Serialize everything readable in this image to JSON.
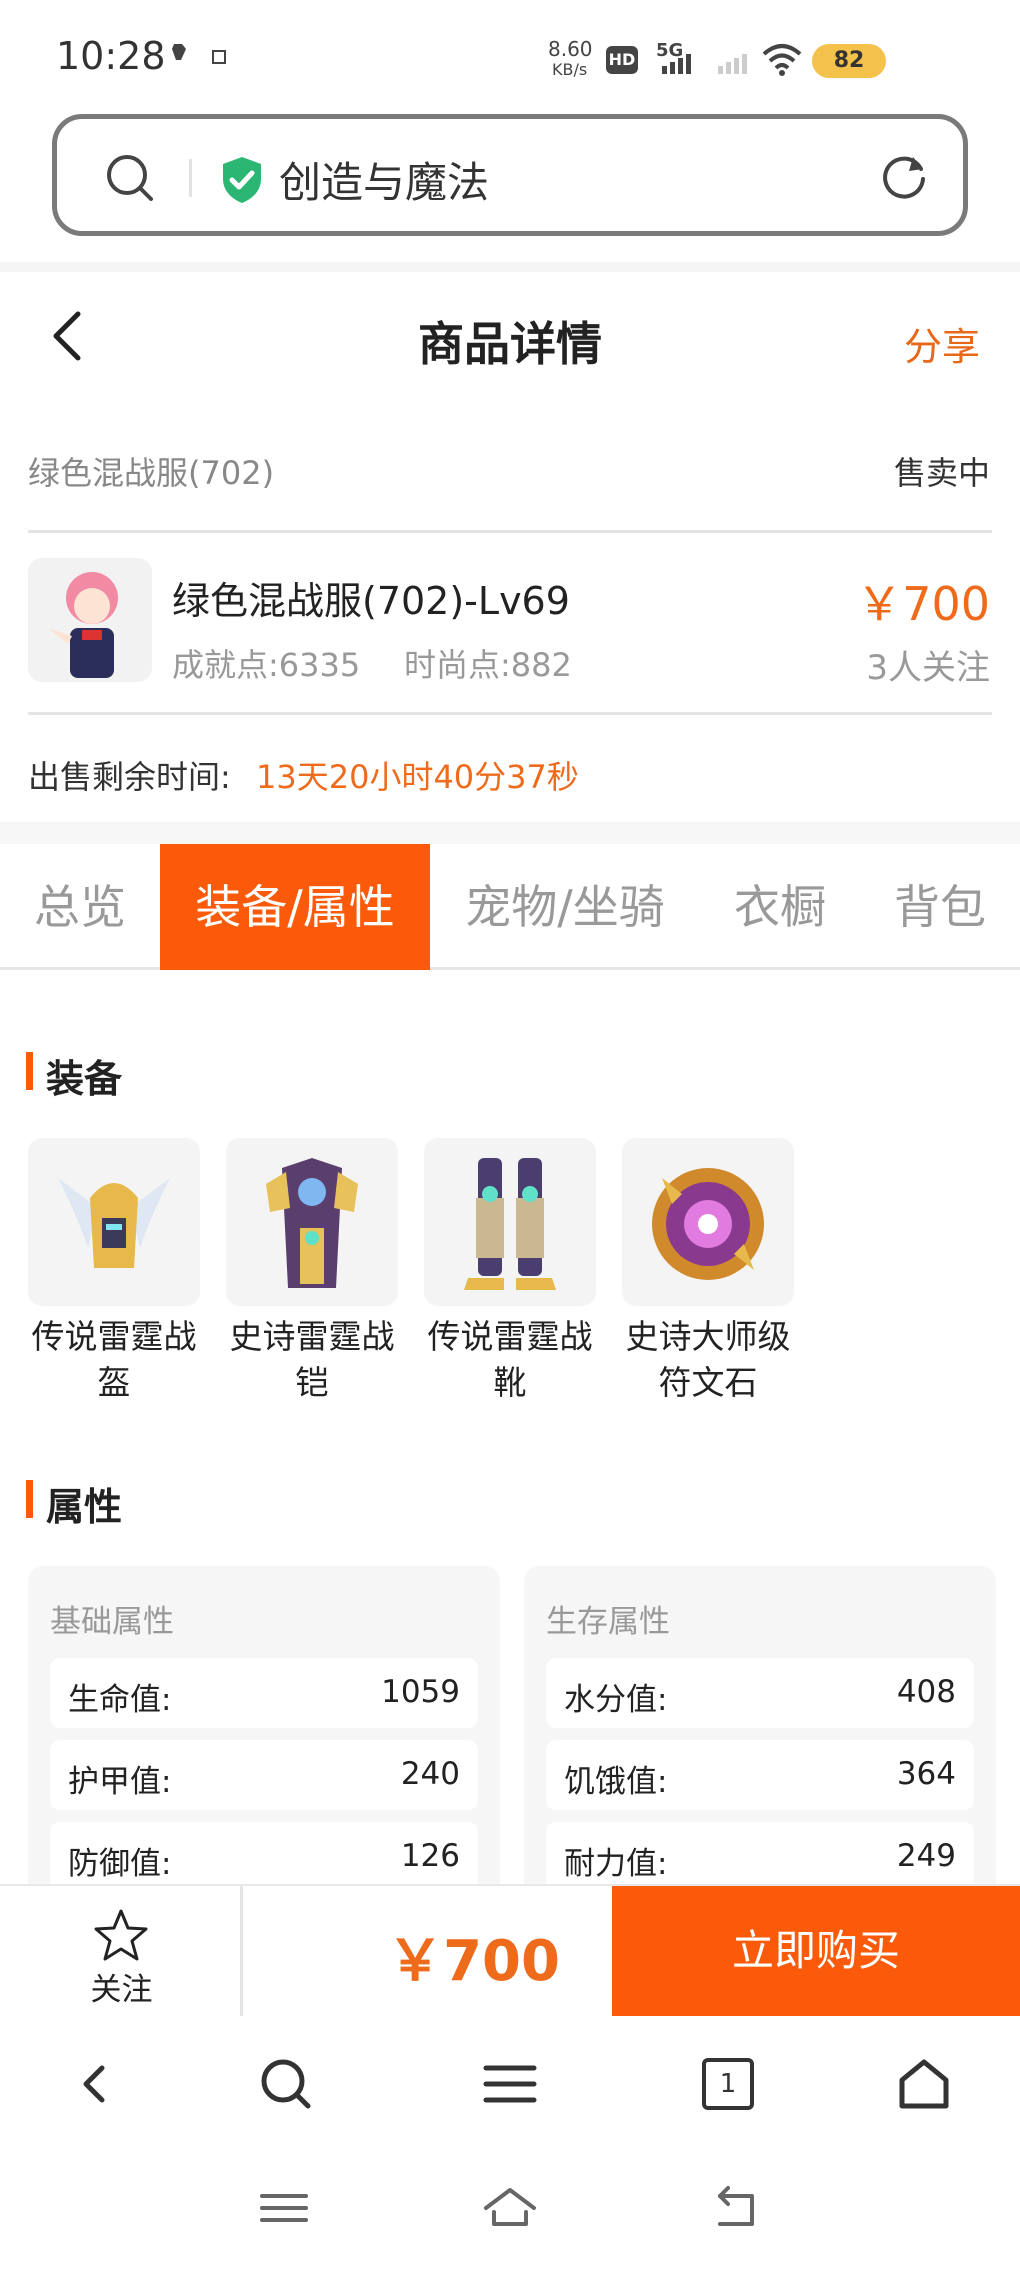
{
  "status_bar": {
    "time": "10:28",
    "net_speed_value": "8.60",
    "net_speed_unit": "KB/s",
    "hd_label": "HD",
    "network_label": "5G",
    "battery": "82"
  },
  "address_bar": {
    "text": "创造与魔法"
  },
  "header": {
    "title": "商品详情",
    "share": "分享"
  },
  "item": {
    "name_small": "绿色混战服(702)",
    "status": "售卖中",
    "title": "绿色混战服(702)-Lv69",
    "achievement": "成就点:6335",
    "fashion": "时尚点:882",
    "price": "￥700",
    "followers": "3人关注",
    "remaining_label": "出售剩余时间:",
    "remaining_value": "13天20小时40分37秒"
  },
  "tabs": [
    {
      "label": "总览",
      "active": false
    },
    {
      "label": "装备/属性",
      "active": true
    },
    {
      "label": "宠物/坐骑",
      "active": false
    },
    {
      "label": "衣橱",
      "active": false
    },
    {
      "label": "背包",
      "active": false
    }
  ],
  "equipment": {
    "title": "装备",
    "items": [
      {
        "line1": "传说雷霆战",
        "line2": "盔"
      },
      {
        "line1": "史诗雷霆战",
        "line2": "铠"
      },
      {
        "line1": "传说雷霆战",
        "line2": "靴"
      },
      {
        "line1": "史诗大师级",
        "line2": "符文石"
      }
    ]
  },
  "attributes": {
    "title": "属性",
    "basic": {
      "title": "基础属性",
      "rows": [
        {
          "k": "生命值:",
          "v": "1059"
        },
        {
          "k": "护甲值:",
          "v": "240"
        },
        {
          "k": "防御值:",
          "v": "126"
        }
      ]
    },
    "survival": {
      "title": "生存属性",
      "rows": [
        {
          "k": "水分值:",
          "v": "408"
        },
        {
          "k": "饥饿值:",
          "v": "364"
        },
        {
          "k": "耐力值:",
          "v": "249"
        }
      ]
    }
  },
  "buy_bar": {
    "follow": "关注",
    "price": "￥700",
    "buy": "立即购买"
  },
  "browser_nav": {
    "tab_count": "1"
  },
  "colors": {
    "accent": "#fb5a0a",
    "price": "#ef6b1c",
    "muted": "#999999"
  }
}
